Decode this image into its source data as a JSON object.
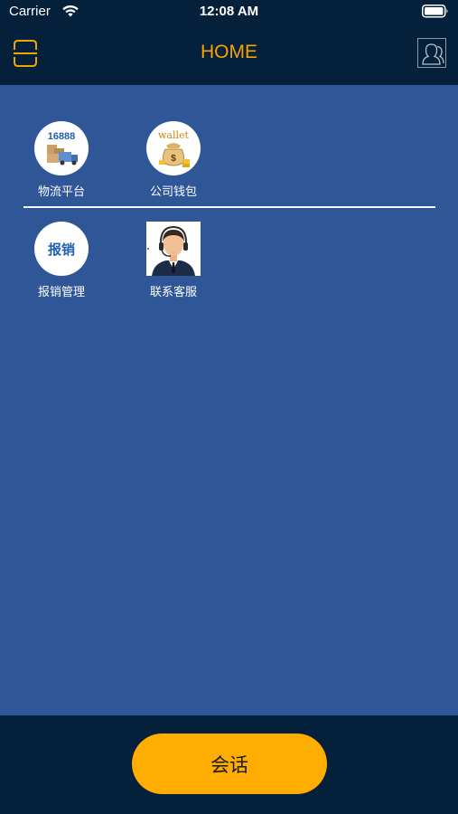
{
  "status_bar": {
    "carrier": "Carrier",
    "time": "12:08 AM"
  },
  "header": {
    "title": "HOME"
  },
  "tiles_row1": [
    {
      "label": "物流平台",
      "icon_text": "16888"
    },
    {
      "label": "公司钱包",
      "icon_text": "wallet"
    }
  ],
  "tiles_row2": [
    {
      "label": "报销管理",
      "icon_text": "报销"
    },
    {
      "label": "联系客服"
    }
  ],
  "bottom": {
    "chat_label": "会话"
  },
  "colors": {
    "nav_background": "#04203a",
    "content_background": "#2f5697",
    "accent": "#f5a300",
    "chat_button": "#ffad00"
  }
}
